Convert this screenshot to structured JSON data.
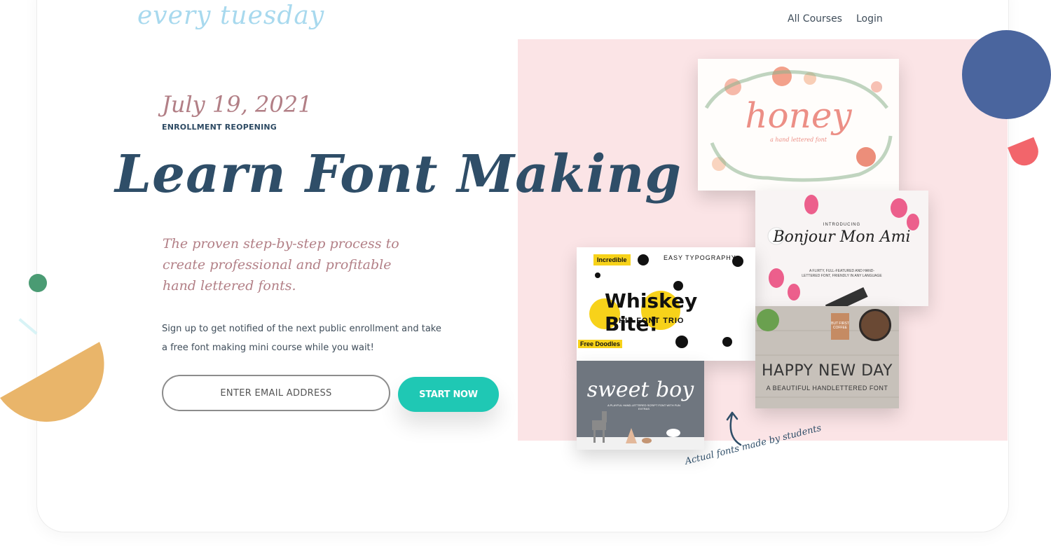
{
  "brand": {
    "logo_text": "every tuesday"
  },
  "nav": {
    "all_courses": "All Courses",
    "login": "Login"
  },
  "hero": {
    "date": "July 19, 2021",
    "eyebrow": "ENROLLMENT REOPENING",
    "headline": "Learn Font Making",
    "tagline": "The proven step-by-step process to create professional and profitable hand lettered fonts.",
    "signup_text": "Sign up to get notified of the next public enrollment and take a free font making mini course while you wait!"
  },
  "form": {
    "email_placeholder": "ENTER EMAIL ADDRESS",
    "submit_label": "START NOW"
  },
  "gallery": {
    "honey": {
      "title": "honey",
      "subtitle": "a hand lettered font"
    },
    "bonjour": {
      "intro": "INTRODUCING",
      "title": "Bonjour Mon Ami",
      "description": "A FLIRTY, FULL-FEATURED AND HAND-LETTERED FONT, FRIENDLY IN ANY LANGUAGE"
    },
    "whiskey": {
      "title": "Whiskey Bite!",
      "subtitle": "HIP FONT TRIO",
      "easy": "EASY TYPOGRAPHY",
      "incredible": "Incredible",
      "free": "Free Doodles"
    },
    "happy": {
      "note": "BUT FIRST COFFEE",
      "title": "HAPPY NEW DAY",
      "subtitle": "A BEAUTIFUL HANDLETTERED FONT"
    },
    "sweet": {
      "title": "sweet boy",
      "description": "A PLAYFUL HAND-LETTERED SCRIPT FONT WITH FUN EXTRAS"
    },
    "caption": "Actual fonts made by students"
  },
  "colors": {
    "navy": "#2f4e68",
    "rose": "#b27f86",
    "teal": "#1fc8b4",
    "pink_panel": "#fbe4e6",
    "blue_circle": "#4a659e",
    "red_semicircle": "#f2656b",
    "green_dot": "#4a9b73",
    "orange_semicircle": "#e9b56a"
  }
}
